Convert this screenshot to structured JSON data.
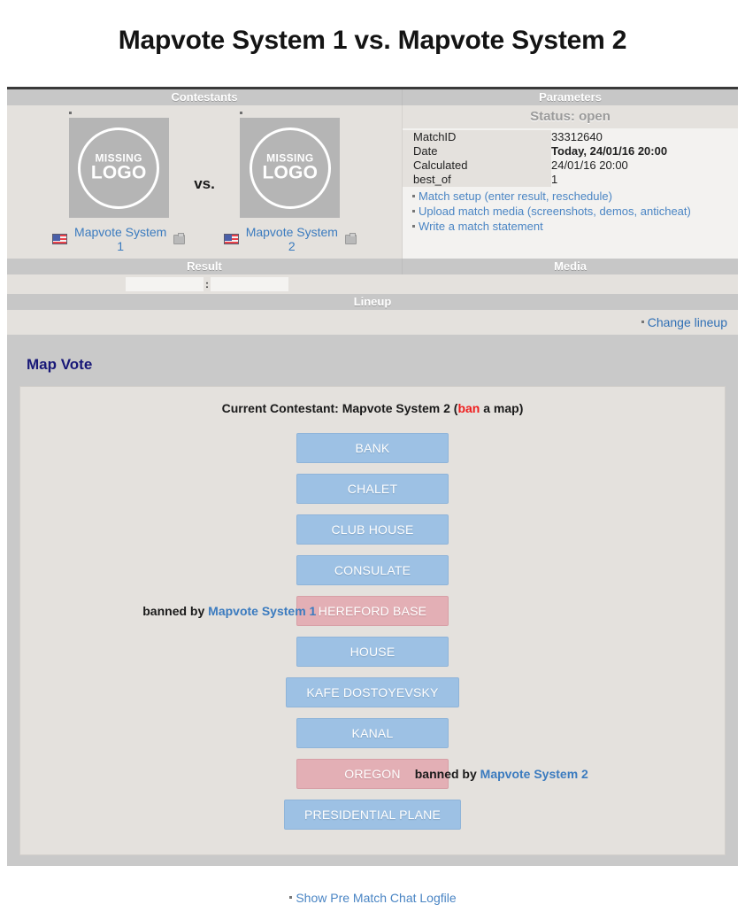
{
  "title": "Mapvote System 1 vs. Mapvote System 2",
  "sections": {
    "contestants_header": "Contestants",
    "parameters_header": "Parameters",
    "result_header": "Result",
    "media_header": "Media",
    "lineup_header": "Lineup"
  },
  "status": "Status: open",
  "contestants": {
    "vs_label": "vs.",
    "logo_placeholder_line1": "MISSING",
    "logo_placeholder_line2": "LOGO",
    "team1": "Mapvote System 1",
    "team2": "Mapvote System 2"
  },
  "parameters": {
    "rows": [
      {
        "key": "MatchID",
        "value": "33312640",
        "bold": false
      },
      {
        "key": "Date",
        "value": "Today, 24/01/16 20:00",
        "bold": true
      },
      {
        "key": "Calculated",
        "value": "24/01/16 20:00",
        "bold": false
      },
      {
        "key": "best_of",
        "value": "1",
        "bold": false
      }
    ],
    "links": [
      "Match setup (enter result, reschedule)",
      "Upload match media (screenshots, demos, anticheat)",
      "Write a match statement"
    ]
  },
  "result": {
    "score_home": "",
    "score_away": "",
    "separator": ":",
    "placeholder": ""
  },
  "lineup": {
    "change_link": "Change lineup"
  },
  "mapvote": {
    "title": "Map Vote",
    "current_prefix": "Current Contestant: ",
    "current_contestant": "Mapvote System 2",
    "action_open": " (",
    "action_word": "ban",
    "action_suffix": " a map)",
    "banned_by_label": "banned by ",
    "banned_by_team1": "Mapvote System 1",
    "banned_by_team2": "Mapvote System 2",
    "maps": [
      {
        "name": "BANK",
        "banned": false,
        "banned_by": null
      },
      {
        "name": "CHALET",
        "banned": false,
        "banned_by": null
      },
      {
        "name": "CLUB HOUSE",
        "banned": false,
        "banned_by": null
      },
      {
        "name": "CONSULATE",
        "banned": false,
        "banned_by": null
      },
      {
        "name": "HEREFORD BASE",
        "banned": true,
        "banned_by": "Mapvote System 1"
      },
      {
        "name": "HOUSE",
        "banned": false,
        "banned_by": null
      },
      {
        "name": "KAFE DOSTOYEVSKY",
        "banned": false,
        "banned_by": null
      },
      {
        "name": "KANAL",
        "banned": false,
        "banned_by": null
      },
      {
        "name": "OREGON",
        "banned": true,
        "banned_by": "Mapvote System 2"
      },
      {
        "name": "PRESIDENTIAL PLANE",
        "banned": false,
        "banned_by": null
      }
    ]
  },
  "footer": {
    "chat_log_link": "Show Pre Match Chat Logfile"
  },
  "colors": {
    "map_available": "#9dc1e4",
    "map_banned": "#e3afb5",
    "link": "#4a85c4",
    "ban_word": "#ef1d1d",
    "heading": "#181878"
  }
}
